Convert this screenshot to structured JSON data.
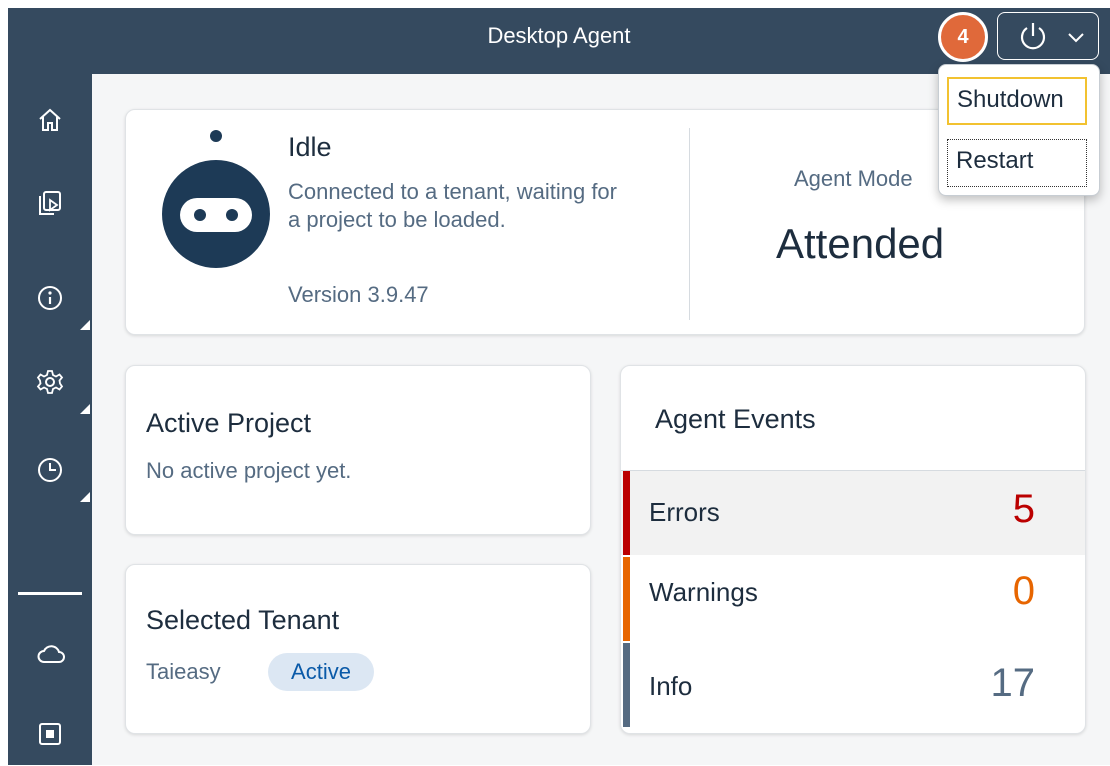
{
  "header": {
    "title": "Desktop Agent",
    "notification_count": "4",
    "power_button_icon": "power-icon",
    "dropdown_icon": "chevron-down-icon"
  },
  "power_menu": {
    "items": [
      {
        "label": "Shutdown"
      },
      {
        "label": "Restart"
      }
    ]
  },
  "sidebar": {
    "items": [
      {
        "icon": "home-icon"
      },
      {
        "icon": "screen-play-icon"
      },
      {
        "icon": "info-icon"
      },
      {
        "icon": "gear-icon"
      },
      {
        "icon": "clock-icon"
      },
      {
        "icon": "cloud-icon"
      },
      {
        "icon": "record-icon"
      }
    ]
  },
  "status": {
    "title": "Idle",
    "description": "Connected to a tenant, waiting for a project to be loaded.",
    "version": "Version 3.9.47",
    "mode_label": "Agent Mode",
    "mode_value": "Attended"
  },
  "active_project": {
    "title": "Active Project",
    "subtitle": "No active project yet."
  },
  "selected_tenant": {
    "title": "Selected Tenant",
    "name": "Taieasy",
    "status": "Active"
  },
  "agent_events": {
    "title": "Agent Events",
    "rows": [
      {
        "label": "Errors",
        "count": "5",
        "color": "#bb0000"
      },
      {
        "label": "Warnings",
        "count": "0",
        "color": "#e76500"
      },
      {
        "label": "Info",
        "count": "17",
        "color": "#556b82"
      }
    ]
  },
  "colors": {
    "shell": "#354a5f",
    "badge": "#e0693a",
    "accent": "#0a6ed1"
  }
}
